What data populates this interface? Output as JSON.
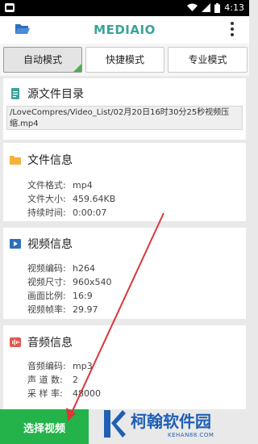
{
  "status": {
    "time": "4:13"
  },
  "app": {
    "title": "MEDIAIO"
  },
  "modes": [
    "自动模式",
    "快捷模式",
    "专业模式"
  ],
  "source": {
    "title": "源文件目录",
    "path": "/LoveCompres/Video_List/02月20日16时30分25秒视频压缩.mp4"
  },
  "file_info": {
    "title": "文件信息",
    "rows": [
      {
        "k": "文件格式:",
        "v": "mp4"
      },
      {
        "k": "文件大小:",
        "v": "459.64KB"
      },
      {
        "k": "持续时间:",
        "v": "0:00:07"
      }
    ]
  },
  "video_info": {
    "title": "视频信息",
    "rows": [
      {
        "k": "视频编码:",
        "v": "h264"
      },
      {
        "k": "视频尺寸:",
        "v": "960x540"
      },
      {
        "k": "画面比例:",
        "v": "16:9"
      },
      {
        "k": "视频帧率:",
        "v": "29.97"
      }
    ]
  },
  "audio_info": {
    "title": "音频信息",
    "rows": [
      {
        "k": "音频编码:",
        "v": "mp3"
      },
      {
        "k": "声 道 数:",
        "v": "2"
      },
      {
        "k": "采 样 率:",
        "v": "48000"
      }
    ]
  },
  "bottom": {
    "select_label": "选择视频"
  },
  "watermark": {
    "brand": "柯翰软件园",
    "url": "KEHAN88.COM"
  },
  "colors": {
    "accent": "#3aa39a",
    "green": "#23b34a",
    "arrow": "#d9373a",
    "brand_blue": "#1f5fb5"
  }
}
